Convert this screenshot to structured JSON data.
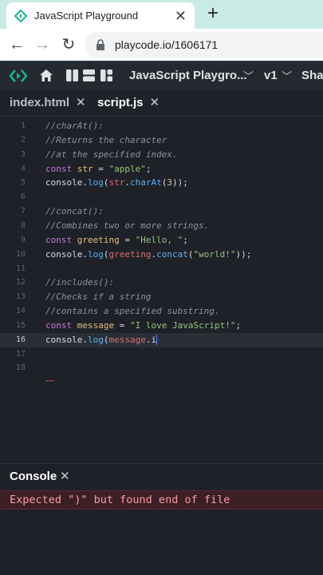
{
  "browser": {
    "tab_title": "JavaScript Playground",
    "url": "playcode.io/1606171"
  },
  "app": {
    "project_title": "JavaScript Playgro...",
    "version": "v1",
    "share_label": "Sha"
  },
  "file_tabs": [
    {
      "name": "index.html",
      "active": false
    },
    {
      "name": "script.js",
      "active": true
    }
  ],
  "editor": {
    "active_line": 16,
    "lines": [
      {
        "n": "1",
        "tokens": [
          {
            "c": "cm",
            "t": "//charAt():"
          }
        ]
      },
      {
        "n": "2",
        "tokens": [
          {
            "c": "cm",
            "t": "//Returns the character"
          }
        ]
      },
      {
        "n": "3",
        "tokens": [
          {
            "c": "cm",
            "t": "//at the specified index."
          }
        ]
      },
      {
        "n": "4",
        "tokens": [
          {
            "c": "kw",
            "t": "const "
          },
          {
            "c": "vr",
            "t": "str"
          },
          {
            "c": "op",
            "t": " = "
          },
          {
            "c": "st",
            "t": "\"apple\""
          },
          {
            "c": "op",
            "t": ";"
          }
        ]
      },
      {
        "n": "5",
        "tokens": [
          {
            "c": "op",
            "t": "console."
          },
          {
            "c": "fn",
            "t": "log"
          },
          {
            "c": "op",
            "t": "("
          },
          {
            "c": "id",
            "t": "str"
          },
          {
            "c": "op",
            "t": "."
          },
          {
            "c": "fn",
            "t": "charAt"
          },
          {
            "c": "op",
            "t": "("
          },
          {
            "c": "vr",
            "t": "3"
          },
          {
            "c": "op",
            "t": "));"
          }
        ]
      },
      {
        "n": "6",
        "tokens": []
      },
      {
        "n": "7",
        "tokens": [
          {
            "c": "cm",
            "t": "//concat():"
          }
        ]
      },
      {
        "n": "8",
        "tokens": [
          {
            "c": "cm",
            "t": "//Combines two or more strings."
          }
        ]
      },
      {
        "n": "9",
        "tokens": [
          {
            "c": "kw",
            "t": "const "
          },
          {
            "c": "vr",
            "t": "greeting"
          },
          {
            "c": "op",
            "t": " = "
          },
          {
            "c": "st",
            "t": "\"Hello, \""
          },
          {
            "c": "op",
            "t": ";"
          }
        ]
      },
      {
        "n": "10",
        "tokens": [
          {
            "c": "op",
            "t": "console."
          },
          {
            "c": "fn",
            "t": "log"
          },
          {
            "c": "op",
            "t": "("
          },
          {
            "c": "id",
            "t": "greeting"
          },
          {
            "c": "op",
            "t": "."
          },
          {
            "c": "fn",
            "t": "concat"
          },
          {
            "c": "op",
            "t": "("
          },
          {
            "c": "st",
            "t": "\"world!\""
          },
          {
            "c": "op",
            "t": "));"
          }
        ]
      },
      {
        "n": "11",
        "tokens": []
      },
      {
        "n": "12",
        "tokens": [
          {
            "c": "cm",
            "t": "//includes():"
          }
        ]
      },
      {
        "n": "13",
        "tokens": [
          {
            "c": "cm",
            "t": "//Checks if a string"
          }
        ]
      },
      {
        "n": "14",
        "tokens": [
          {
            "c": "cm",
            "t": "//contains a specified substring."
          }
        ]
      },
      {
        "n": "15",
        "tokens": [
          {
            "c": "kw",
            "t": "const "
          },
          {
            "c": "vr",
            "t": "message"
          },
          {
            "c": "op",
            "t": " = "
          },
          {
            "c": "st",
            "t": "\"I love JavaScript!\""
          },
          {
            "c": "op",
            "t": ";"
          }
        ]
      },
      {
        "n": "16",
        "tokens": [
          {
            "c": "op",
            "t": "console."
          },
          {
            "c": "fn",
            "t": "log"
          },
          {
            "c": "op",
            "t": "("
          },
          {
            "c": "id",
            "t": "message"
          },
          {
            "c": "op",
            "t": ".i"
          }
        ]
      },
      {
        "n": "17",
        "tokens": []
      },
      {
        "n": "18",
        "tokens": []
      }
    ]
  },
  "console": {
    "title": "Console",
    "error": "Expected \")\" but found end of file"
  },
  "colors": {
    "accent": "#1ab394",
    "error_bg": "#3b1f25",
    "error_text": "#ff9ca6"
  }
}
